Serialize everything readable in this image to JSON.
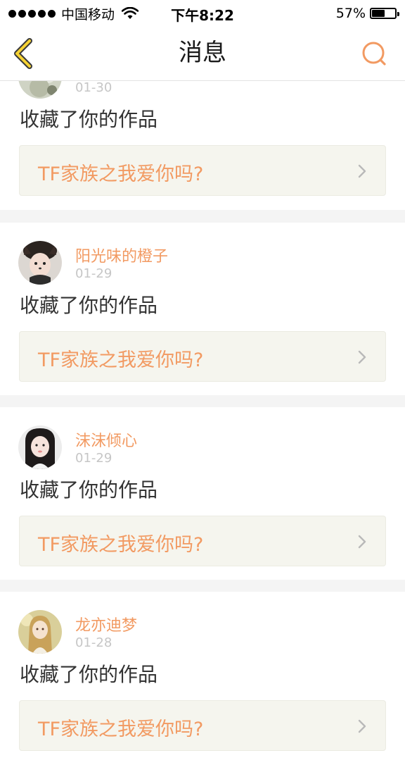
{
  "status_bar": {
    "carrier": "中国移动",
    "time": "下午8:22",
    "battery": "57%",
    "battery_level": 0.57
  },
  "nav": {
    "title": "消息",
    "accent_color": "#f29a62"
  },
  "messages": [
    {
      "user": "",
      "date": "01-30",
      "action": "收藏了你的作品",
      "work_title": "TF家族之我爱你吗?",
      "avatar_icon": "avatar-1"
    },
    {
      "user": "阳光味的橙子",
      "date": "01-29",
      "action": "收藏了你的作品",
      "work_title": "TF家族之我爱你吗?",
      "avatar_icon": "avatar-2"
    },
    {
      "user": "沫沫倾心",
      "date": "01-29",
      "action": "收藏了你的作品",
      "work_title": "TF家族之我爱你吗?",
      "avatar_icon": "avatar-3"
    },
    {
      "user": "龙亦迪梦",
      "date": "01-28",
      "action": "收藏了你的作品",
      "work_title": "TF家族之我爱你吗?",
      "avatar_icon": "avatar-4"
    }
  ]
}
